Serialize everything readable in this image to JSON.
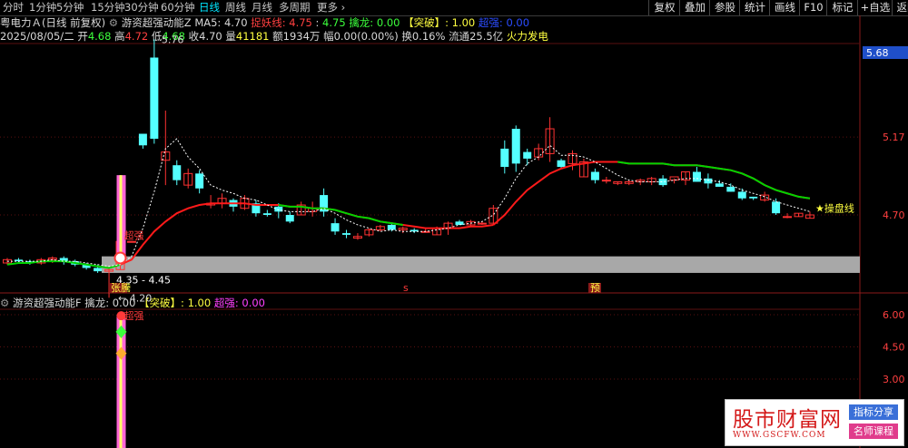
{
  "timeframes": [
    "分时",
    "1分钟",
    "5分钟",
    "15分钟",
    "30分钟",
    "60分钟",
    "日线",
    "周线",
    "月线",
    "多周期",
    "更多"
  ],
  "active_timeframe_index": 6,
  "toolbar_buttons": [
    "复权",
    "叠加",
    "参股",
    "统计",
    "画线",
    "F10",
    "标记",
    "+自选",
    "返回"
  ],
  "info": {
    "stock_name": "粤电力Ａ(日线 前复权)",
    "indicator_name": "游资超强动能Z",
    "ma5_label": "MA5:",
    "ma5_value": "4.70",
    "zhuoyao_label": "捉妖线:",
    "zhuoyao_value": "4.75",
    "zhuoyao_value2": "4.75",
    "qinlong_label": "擒龙:",
    "qinlong_value": "0.00",
    "tupo_label": "【突破】:",
    "tupo_value": "1.00",
    "chaoqiang_label": "超强:",
    "chaoqiang_value": "0.00",
    "date": "2025/08/05/二",
    "open_label": "开",
    "open_value": "4.68",
    "high_label": "高",
    "high_value": "4.72",
    "low_label": "低",
    "low_value": "4.68",
    "close_label": "收",
    "close_value": "4.70",
    "volume_label": "量",
    "volume_value": "41181",
    "amount_label": "额",
    "amount_value": "1934万",
    "change_label": "幅",
    "change_value": "0.00(0.00%)",
    "turnover_label": "换",
    "turnover_value": "0.16%",
    "float_label": "流通",
    "float_value": "25.5亿",
    "concept": "火力发电"
  },
  "sub_info": {
    "indicator_name": "游资超强动能F",
    "qinlong_label": "擒龙:",
    "qinlong_value": "0.00",
    "tupo_label": "【突破】:",
    "tupo_value": "1.00",
    "chaoqiang_label": "超强:",
    "chaoqiang_value": "0.00"
  },
  "chart_data": {
    "type": "candlestick",
    "y_axis_ticks": [
      "5.68",
      "5.17",
      "4.70"
    ],
    "current_price_box": "5.68",
    "annotations": {
      "max_price": "5.76",
      "min_price": "4.20",
      "band_label": "4.35 - 4.45",
      "chaoqiang_label": "超强",
      "caopan_label": "★操盘线",
      "zhangting_label": "张",
      "marker_s": "s",
      "marker_yu": "预"
    },
    "band": {
      "low": 4.35,
      "high": 4.45
    },
    "colors": {
      "up": "#ff3232",
      "down": "#54ffff",
      "ma_green": "#00d400",
      "ma_red": "#ff1a1a",
      "ma_white": "#ffffff",
      "band": "#a8a8a8"
    },
    "candles": [
      [
        4.41,
        4.44,
        4.4,
        4.43
      ],
      [
        4.43,
        4.44,
        4.41,
        4.42
      ],
      [
        4.42,
        4.43,
        4.4,
        4.41
      ],
      [
        4.41,
        4.44,
        4.4,
        4.43
      ],
      [
        4.43,
        4.45,
        4.41,
        4.44
      ],
      [
        4.44,
        4.45,
        4.4,
        4.42
      ],
      [
        4.42,
        4.43,
        4.39,
        4.4
      ],
      [
        4.4,
        4.41,
        4.37,
        4.38
      ],
      [
        4.38,
        4.4,
        4.35,
        4.36
      ],
      [
        4.36,
        4.38,
        4.2,
        4.37
      ],
      [
        4.37,
        4.55,
        4.37,
        4.54
      ],
      [
        4.54,
        4.54,
        4.54,
        4.54
      ],
      [
        5.19,
        5.19,
        5.1,
        5.12
      ],
      [
        5.65,
        5.76,
        5.13,
        5.16
      ],
      [
        5.03,
        5.33,
        4.88,
        5.08
      ],
      [
        5.0,
        5.03,
        4.88,
        4.91
      ],
      [
        4.88,
        4.98,
        4.86,
        4.95
      ],
      [
        4.95,
        4.97,
        4.83,
        4.86
      ],
      [
        4.76,
        4.82,
        4.74,
        4.77
      ],
      [
        4.77,
        4.83,
        4.74,
        4.8
      ],
      [
        4.79,
        4.8,
        4.72,
        4.75
      ],
      [
        4.74,
        4.82,
        4.73,
        4.8
      ],
      [
        4.77,
        4.79,
        4.69,
        4.71
      ],
      [
        4.71,
        4.73,
        4.69,
        4.7
      ],
      [
        4.75,
        4.77,
        4.68,
        4.72
      ],
      [
        4.7,
        4.72,
        4.65,
        4.66
      ],
      [
        4.7,
        4.78,
        4.7,
        4.76
      ],
      [
        4.72,
        4.78,
        4.69,
        4.74
      ],
      [
        4.82,
        4.86,
        4.69,
        4.72
      ],
      [
        4.65,
        4.68,
        4.58,
        4.6
      ],
      [
        4.59,
        4.61,
        4.56,
        4.58
      ],
      [
        4.56,
        4.59,
        4.55,
        4.57
      ],
      [
        4.58,
        4.62,
        4.57,
        4.61
      ],
      [
        4.61,
        4.64,
        4.6,
        4.63
      ],
      [
        4.64,
        4.65,
        4.6,
        4.61
      ],
      [
        4.61,
        4.63,
        4.59,
        4.62
      ],
      [
        4.61,
        4.62,
        4.59,
        4.6
      ],
      [
        4.6,
        4.62,
        4.6,
        4.6
      ],
      [
        4.58,
        4.63,
        4.58,
        4.62
      ],
      [
        4.62,
        4.66,
        4.58,
        4.65
      ],
      [
        4.66,
        4.67,
        4.64,
        4.64
      ],
      [
        4.64,
        4.67,
        4.63,
        4.66
      ],
      [
        4.65,
        4.66,
        4.64,
        4.65
      ],
      [
        4.65,
        4.76,
        4.64,
        4.74
      ],
      [
        5.1,
        5.15,
        4.95,
        4.99
      ],
      [
        5.22,
        5.24,
        4.96,
        5.01
      ],
      [
        5.08,
        5.1,
        5.0,
        5.04
      ],
      [
        5.05,
        5.13,
        5.03,
        5.1
      ],
      [
        5.07,
        5.29,
        5.02,
        5.22
      ],
      [
        5.03,
        5.04,
        4.98,
        4.99
      ],
      [
        5.01,
        5.09,
        4.97,
        5.07
      ],
      [
        4.93,
        5.04,
        4.93,
        5.02
      ],
      [
        4.96,
        4.98,
        4.89,
        4.91
      ],
      [
        4.91,
        4.93,
        4.89,
        4.91
      ],
      [
        4.89,
        4.9,
        4.88,
        4.9
      ],
      [
        4.89,
        4.91,
        4.88,
        4.9
      ],
      [
        4.9,
        4.92,
        4.88,
        4.91
      ],
      [
        4.9,
        4.93,
        4.88,
        4.92
      ],
      [
        4.92,
        4.94,
        4.87,
        4.88
      ],
      [
        4.91,
        4.92,
        4.89,
        4.93
      ],
      [
        4.91,
        4.96,
        4.88,
        4.96
      ],
      [
        4.96,
        4.99,
        4.9,
        4.9
      ],
      [
        4.92,
        4.95,
        4.86,
        4.89
      ],
      [
        4.89,
        4.91,
        4.87,
        4.87
      ],
      [
        4.87,
        4.89,
        4.84,
        4.84
      ],
      [
        4.84,
        4.86,
        4.79,
        4.8
      ],
      [
        4.81,
        4.81,
        4.79,
        4.8
      ],
      [
        4.79,
        4.84,
        4.78,
        4.82
      ],
      [
        4.78,
        4.8,
        4.7,
        4.71
      ],
      [
        4.69,
        4.71,
        4.68,
        4.69
      ],
      [
        4.69,
        4.71,
        4.69,
        4.71
      ],
      [
        4.68,
        4.72,
        4.68,
        4.7
      ]
    ],
    "ma_line": [
      4.4,
      4.41,
      4.41,
      4.42,
      4.42,
      4.42,
      4.41,
      4.4,
      4.39,
      4.38,
      4.4,
      4.43,
      4.52,
      4.6,
      4.66,
      4.71,
      4.74,
      4.76,
      4.77,
      4.77,
      4.77,
      4.77,
      4.76,
      4.76,
      4.76,
      4.75,
      4.75,
      4.74,
      4.74,
      4.73,
      4.71,
      4.69,
      4.68,
      4.66,
      4.65,
      4.64,
      4.63,
      4.62,
      4.62,
      4.62,
      4.62,
      4.63,
      4.63,
      4.64,
      4.7,
      4.78,
      4.85,
      4.9,
      4.95,
      4.98,
      5.0,
      5.01,
      5.02,
      5.02,
      5.02,
      5.01,
      5.01,
      5.01,
      5.01,
      5.0,
      5.0,
      5.0,
      4.99,
      4.98,
      4.97,
      4.95,
      4.92,
      4.88,
      4.85,
      4.83,
      4.81,
      4.8
    ],
    "ma_split_index": 43,
    "ma5_line": [
      4.42,
      4.42,
      4.42,
      4.42,
      4.43,
      4.42,
      4.42,
      4.41,
      4.4,
      4.39,
      4.4,
      4.45,
      4.62,
      4.84,
      5.1,
      5.16,
      5.05,
      4.98,
      4.88,
      4.85,
      4.83,
      4.8,
      4.79,
      4.76,
      4.73,
      4.72,
      4.72,
      4.72,
      4.74,
      4.71,
      4.67,
      4.64,
      4.62,
      4.6,
      4.61,
      4.6,
      4.6,
      4.6,
      4.61,
      4.62,
      4.64,
      4.65,
      4.66,
      4.7,
      4.8,
      4.92,
      5.01,
      5.05,
      5.12,
      5.06,
      5.06,
      5.05,
      5.02,
      4.98,
      4.94,
      4.91,
      4.9,
      4.9,
      4.9,
      4.91,
      4.92,
      4.92,
      4.91,
      4.9,
      4.88,
      4.85,
      4.83,
      4.81,
      4.78,
      4.76,
      4.74,
      4.72
    ],
    "sub_ticks": [
      "6.00",
      "4.50",
      "3.00"
    ]
  }
}
